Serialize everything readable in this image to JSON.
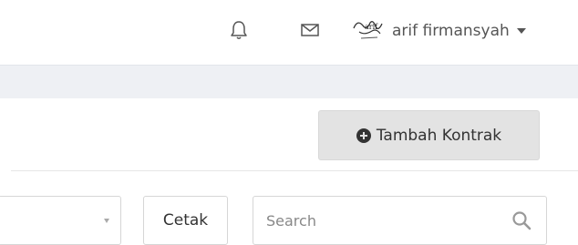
{
  "header": {
    "bell_icon": "bell-icon",
    "mail_icon": "mail-icon",
    "avatar_icon": "signature-avatar",
    "user_name": "arif firmansyah"
  },
  "actions": {
    "add_contract_label": "Tambah Kontrak",
    "add_icon": "plus-circle-icon"
  },
  "toolbar": {
    "print_label": "Cetak",
    "search_placeholder": "Search",
    "search_icon": "search-icon"
  },
  "colors": {
    "band": "#eef0f4",
    "button_gray": "#e3e3e3",
    "border": "#d6d6d6",
    "text": "#333333"
  }
}
